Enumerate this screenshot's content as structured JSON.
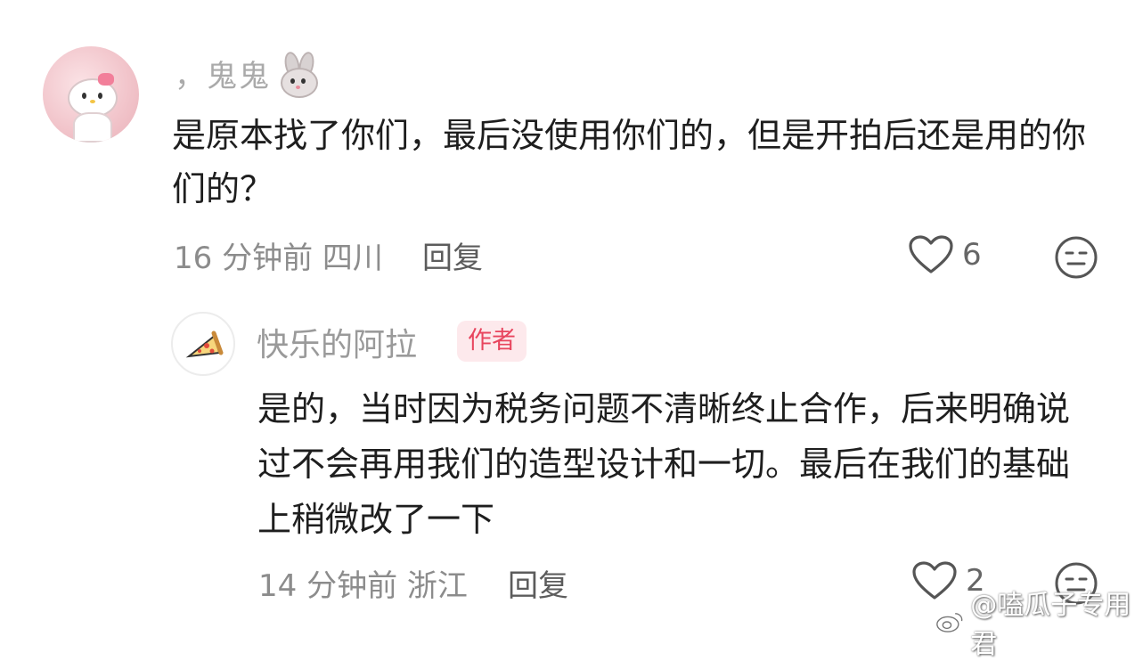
{
  "comment_1": {
    "username": "，​鬼鬼",
    "text": "是原本找了你们，最后没使用你们的，但是开拍后还是用的你们的？",
    "time": "16 分钟前",
    "location": "四川",
    "reply_label": "回复",
    "like_count": "6"
  },
  "comment_2": {
    "username": "快乐的阿拉",
    "badge": "作者",
    "text": "是的，当时因为税务问题不清晰终止合作，后来明确说过不会再用我们的造型设计和一切。最后在我们的基础上稍微改了一下",
    "time": "14 分钟前",
    "location": "浙江",
    "reply_label": "回复",
    "like_count": "2"
  },
  "watermark": {
    "text": "@嗑瓜子专用君"
  },
  "icons": {
    "like": "heart-outline-icon",
    "emoji": "neutral-face-icon",
    "bunny": "rabbit-emoji-icon",
    "pizza": "pizza-slice-icon",
    "weibo": "weibo-logo-icon"
  },
  "colors": {
    "badge_bg": "#fde9ec",
    "badge_text": "#e8455e",
    "meta_text": "#8c8c8c"
  }
}
